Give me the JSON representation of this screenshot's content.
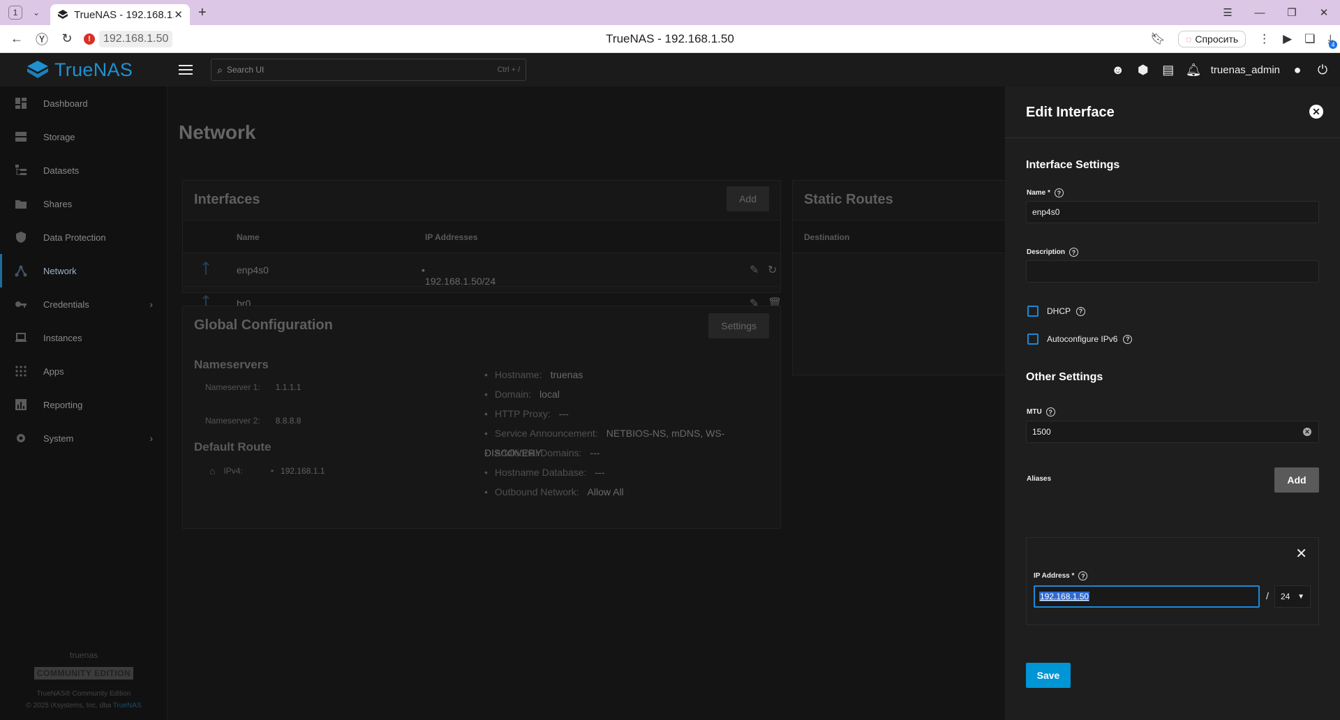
{
  "browser": {
    "tab_count": "1",
    "tab_title": "TrueNAS - 192.168.1.50",
    "url": "192.168.1.50",
    "page_title": "TrueNAS - 192.168.1.50",
    "ask_label": "Спросить",
    "downloads_badge": "4"
  },
  "app": {
    "logo_text": "TrueNAS",
    "search_placeholder": "Search UI",
    "search_shortcut": "Ctrl + /",
    "username": "truenas_admin"
  },
  "sidebar": {
    "items": [
      {
        "label": "Dashboard",
        "icon": "dashboard-icon"
      },
      {
        "label": "Storage",
        "icon": "storage-icon"
      },
      {
        "label": "Datasets",
        "icon": "datasets-icon"
      },
      {
        "label": "Shares",
        "icon": "shares-icon"
      },
      {
        "label": "Data Protection",
        "icon": "shield-icon"
      },
      {
        "label": "Network",
        "icon": "network-icon",
        "active": true
      },
      {
        "label": "Credentials",
        "icon": "key-icon",
        "expandable": true
      },
      {
        "label": "Instances",
        "icon": "laptop-icon"
      },
      {
        "label": "Apps",
        "icon": "apps-grid-icon"
      },
      {
        "label": "Reporting",
        "icon": "chart-icon"
      },
      {
        "label": "System",
        "icon": "gear-icon",
        "expandable": true
      }
    ],
    "footer": {
      "hostname": "truenas",
      "edition_badge": "COMMUNITY EDITION",
      "product": "TrueNAS® Community Edition",
      "copyright": "© 2025 iXsystems, Inc. dba",
      "copyright_link": "TrueNAS"
    }
  },
  "network": {
    "page_title": "Network",
    "interfaces": {
      "title": "Interfaces",
      "add_label": "Add",
      "columns": [
        "Name",
        "IP Addresses"
      ],
      "rows": [
        {
          "name": "enp4s0",
          "ip": "192.168.1.50/24"
        },
        {
          "name": "br0",
          "ip": ""
        }
      ]
    },
    "static_routes": {
      "title": "Static Routes",
      "columns": [
        "Destination"
      ]
    },
    "global_config": {
      "title": "Global Configuration",
      "settings_label": "Settings",
      "nameservers_title": "Nameservers",
      "nameservers": [
        {
          "label": "Nameserver 1:",
          "value": "1.1.1.1"
        },
        {
          "label": "Nameserver 2:",
          "value": "8.8.8.8"
        }
      ],
      "default_route_title": "Default Route",
      "ipv4_label": "IPv4:",
      "ipv4_value": "192.168.1.1",
      "details": [
        {
          "label": "Hostname:",
          "value": "truenas"
        },
        {
          "label": "Domain:",
          "value": "local"
        },
        {
          "label": "HTTP Proxy:",
          "value": "---"
        },
        {
          "label": "Service Announcement:",
          "value": "NETBIOS-NS, mDNS, WS-DISCOVERY"
        },
        {
          "label": "Additional Domains:",
          "value": "---"
        },
        {
          "label": "Hostname Database:",
          "value": "---"
        },
        {
          "label": "Outbound Network:",
          "value": "Allow All"
        }
      ]
    }
  },
  "drawer": {
    "title": "Edit Interface",
    "interface_settings_title": "Interface Settings",
    "name_label": "Name *",
    "name_value": "enp4s0",
    "description_label": "Description",
    "description_value": "",
    "dhcp_label": "DHCP",
    "autoconfig_label": "Autoconfigure IPv6",
    "other_settings_title": "Other Settings",
    "mtu_label": "MTU",
    "mtu_value": "1500",
    "aliases_label": "Aliases",
    "add_label": "Add",
    "ip_address_label": "IP Address *",
    "ip_address_value": "192.168.1.50",
    "netmask_value": "24",
    "save_label": "Save"
  },
  "colors": {
    "accent": "#0095d5",
    "logo": "#1f91d1",
    "checkbox": "#1e88d8"
  }
}
